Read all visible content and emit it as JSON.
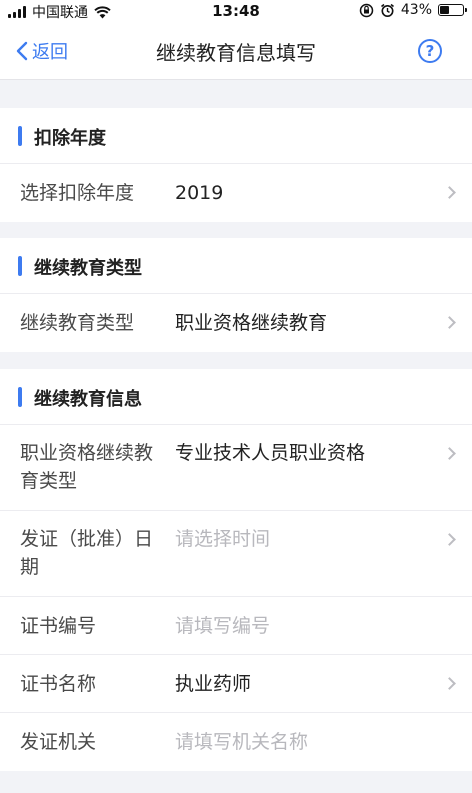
{
  "status": {
    "carrier": "中国联通",
    "time": "13:48",
    "battery": "43%",
    "battery_level": 0.43
  },
  "nav": {
    "back_label": "返回",
    "title": "继续教育信息填写",
    "help_glyph": "?"
  },
  "sections": [
    {
      "title": "扣除年度",
      "rows": [
        {
          "label": "选择扣除年度",
          "value": "2019"
        }
      ]
    },
    {
      "title": "继续教育类型",
      "rows": [
        {
          "label": "继续教育类型",
          "value": "职业资格继续教育"
        }
      ]
    },
    {
      "title": "继续教育信息",
      "rows": [
        {
          "label": "职业资格继续教育类型",
          "value": "专业技术人员职业资格"
        },
        {
          "label": "发证（批准）日期",
          "placeholder": "请选择时间"
        },
        {
          "label": "证书编号",
          "placeholder": "请填写编号"
        },
        {
          "label": "证书名称",
          "value": "执业药师"
        },
        {
          "label": "发证机关",
          "placeholder": "请填写机关名称"
        }
      ]
    }
  ],
  "icons": {
    "back": "chevron-left-icon",
    "help": "help-circle-icon",
    "row": "chevron-right-icon",
    "wifi": "wifi-icon",
    "lock": "orientation-lock-icon",
    "alarm": "alarm-icon"
  },
  "colors": {
    "accent": "#3d7bf0",
    "background": "#f2f3f7",
    "placeholder": "#b8b8bd"
  }
}
